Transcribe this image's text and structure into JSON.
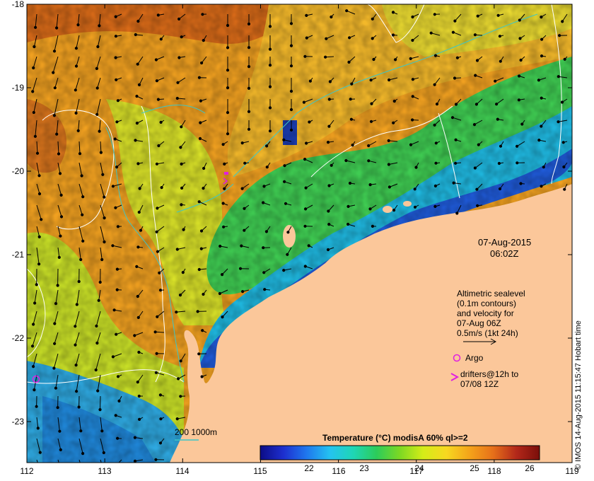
{
  "map": {
    "x_ticks": [
      "112",
      "113",
      "114",
      "115",
      "116",
      "117",
      "118",
      "119"
    ],
    "y_ticks": [
      "-18",
      "-19",
      "-20",
      "-21",
      "-22",
      "-23"
    ],
    "x_range": [
      112,
      119
    ],
    "y_range": [
      -23.5,
      -18
    ],
    "land_color": "#fbc79a",
    "contour_color": "#ffffff",
    "isobath_color": "#3dc6c6",
    "argo_color": "#e020e0"
  },
  "date": {
    "day": "07-Aug-2015",
    "time": "06:02Z"
  },
  "legend": {
    "altimetry_lines": [
      "Altimetric sealevel",
      "(0.1m contours)",
      "and velocity for",
      "07-Aug 06Z",
      "0.5m/s (1kt 24h)"
    ],
    "argo_label": "Argo",
    "drifters_lines": [
      "drifters@12h to",
      "07/08 12Z"
    ],
    "isobath_label": "200  1000m"
  },
  "colorbar": {
    "title": "Temperature (°C) modisA 60% ql>=2",
    "ticks": [
      "22",
      "23",
      "24",
      "25",
      "26"
    ],
    "range": [
      21,
      26.2
    ],
    "colors": [
      "#0c0c86",
      "#1d2fcf",
      "#1f78ee",
      "#24c3f0",
      "#1fd6b4",
      "#2ccc5a",
      "#7dd823",
      "#d5ec18",
      "#f7d820",
      "#f4a31a",
      "#e6701a",
      "#b3281a",
      "#7a0e0a"
    ]
  },
  "credit": "© IMOS 14-Aug-2015 11:15:47 Hobart time"
}
